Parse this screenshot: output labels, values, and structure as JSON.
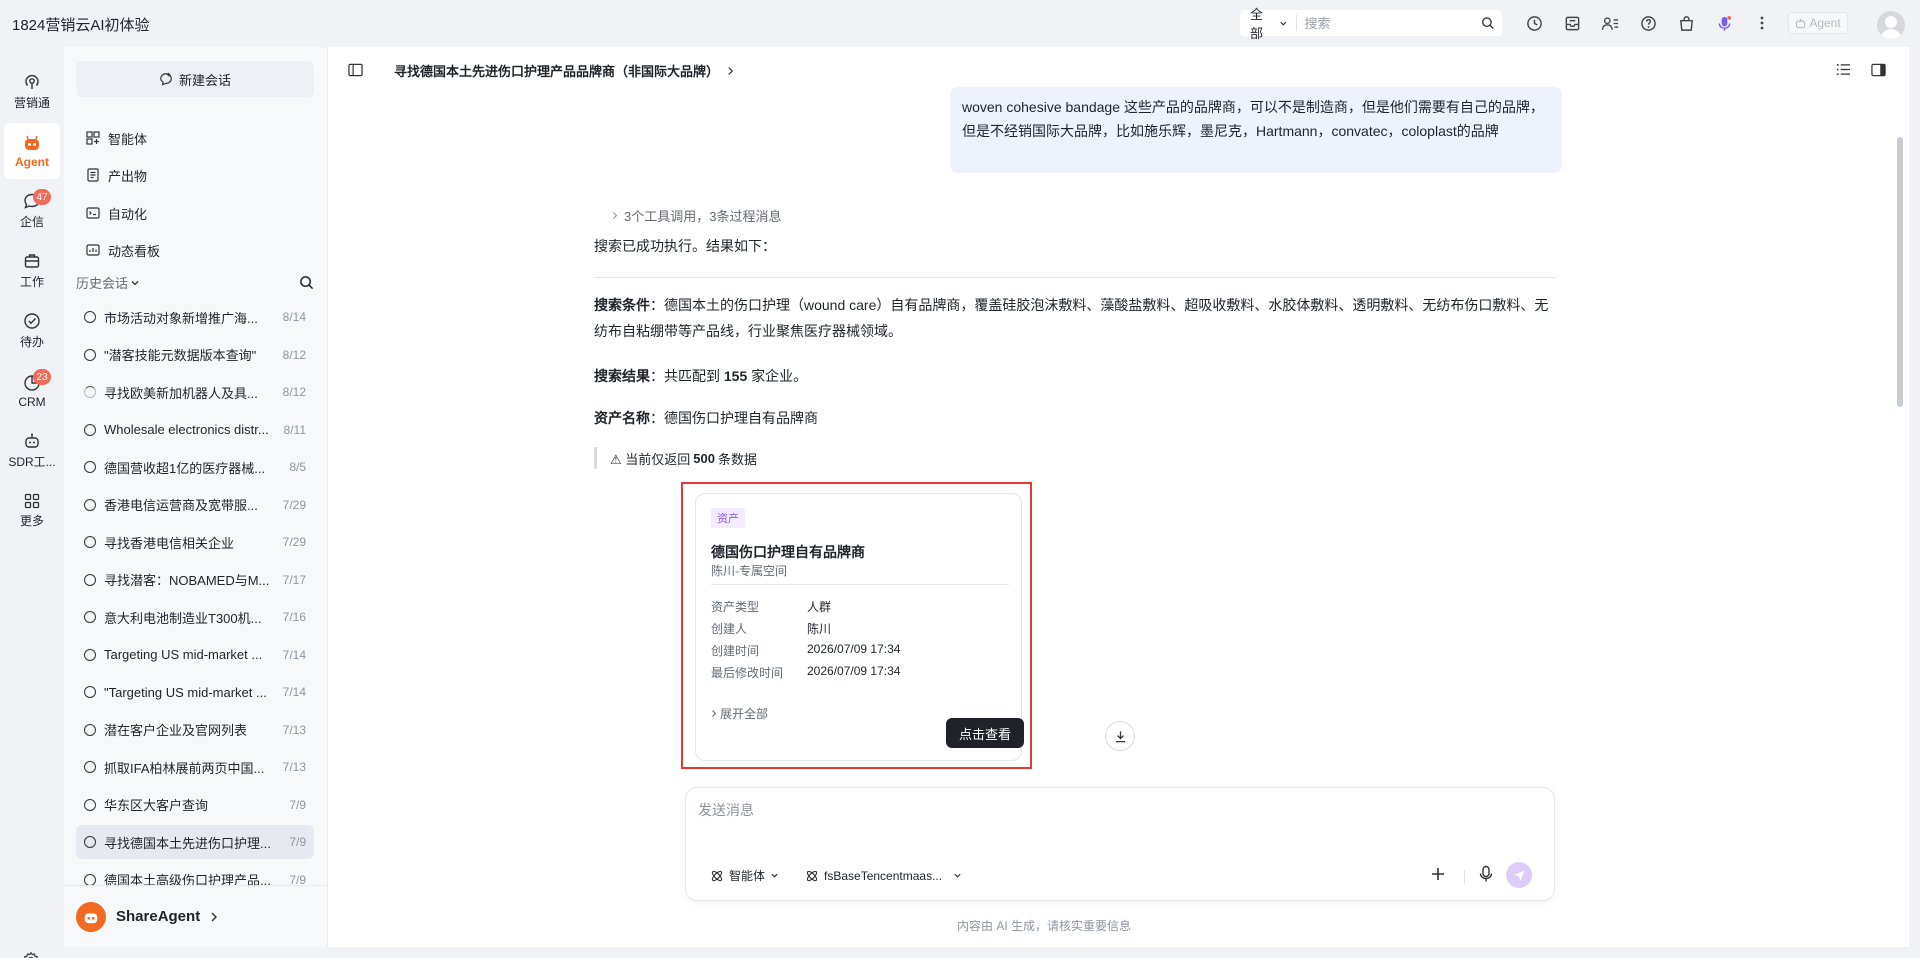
{
  "app": {
    "title": "1824营销云AI初体验"
  },
  "topbar": {
    "search_scope": "全部",
    "search_placeholder": "搜索",
    "agent_label": "Agent"
  },
  "rail": {
    "items": [
      {
        "label": "营销通",
        "icon": "broadcast-icon"
      },
      {
        "label": "Agent",
        "icon": "robot-icon",
        "active": true
      },
      {
        "label": "企信",
        "icon": "chat-icon",
        "badge": "47"
      },
      {
        "label": "工作",
        "icon": "briefcase-icon"
      },
      {
        "label": "待办",
        "icon": "check-circle-icon"
      },
      {
        "label": "CRM",
        "icon": "pie-chart-icon",
        "badge": "23"
      },
      {
        "label": "SDR工...",
        "icon": "bot-icon"
      },
      {
        "label": "更多",
        "icon": "grid-icon"
      }
    ]
  },
  "sidebar": {
    "new_chat": "新建会话",
    "nav": [
      "智能体",
      "产出物",
      "自动化",
      "动态看板"
    ],
    "history_label": "历史会话",
    "history": [
      {
        "title": "市场活动对象新增推广海...",
        "date": "8/14"
      },
      {
        "title": "\"潜客技能元数据版本查询\"",
        "date": "8/12"
      },
      {
        "title": "寻找欧美新加机器人及具...",
        "date": "8/12",
        "loading": true
      },
      {
        "title": "Wholesale electronics distr...",
        "date": "8/11"
      },
      {
        "title": "德国营收超1亿的医疗器械...",
        "date": "8/5"
      },
      {
        "title": "香港电信运营商及宽带服...",
        "date": "7/29"
      },
      {
        "title": "寻找香港电信相关企业",
        "date": "7/29"
      },
      {
        "title": "寻找潜客：NOBAMED与M...",
        "date": "7/17"
      },
      {
        "title": "意大利电池制造业T300机...",
        "date": "7/16"
      },
      {
        "title": "Targeting US mid-market ...",
        "date": "7/14"
      },
      {
        "title": "\"Targeting US mid-market ...",
        "date": "7/14"
      },
      {
        "title": "潜在客户企业及官网列表",
        "date": "7/13"
      },
      {
        "title": "抓取IFA柏林展前两页中国...",
        "date": "7/13"
      },
      {
        "title": "华东区大客户查询",
        "date": "7/9"
      },
      {
        "title": "寻找德国本土先进伤口护理...",
        "date": "7/9",
        "selected": true
      },
      {
        "title": "德国本土高级伤口护理产品...",
        "date": "7/9"
      }
    ],
    "footer_name": "ShareAgent"
  },
  "conversation": {
    "title": "寻找德国本土先进伤口护理产品品牌商（非国际大品牌）",
    "user_message": "woven cohesive bandage 这些产品的品牌商，可以不是制造商，但是他们需要有自己的品牌，但是不经销国际大品牌，比如施乐辉，墨尼克，Hartmann，convatec，coloplast的品牌",
    "tool_summary": "3个工具调用，3条过程消息",
    "intro": "搜索已成功执行。结果如下：",
    "cond_label": "搜索条件",
    "cond_text": "：德国本土的伤口护理（wound care）自有品牌商，覆盖硅胶泡沫敷料、藻酸盐敷料、超吸收敷料、水胶体敷料、透明敷料、无纺布伤口敷料、无纺布自粘绷带等产品线，行业聚焦医疗器械领域。",
    "result_label": "搜索结果",
    "result_prefix": "：共匹配到 ",
    "result_count": "155",
    "result_suffix": " 家企业。",
    "asset_label": "资产名称",
    "asset_text": "：德国伤口护理自有品牌商",
    "warn_prefix": "⚠ 当前仅返回",
    "warn_count": "500",
    "warn_suffix": "条数据"
  },
  "asset_card": {
    "tag": "资产",
    "name": "德国伤口护理自有品牌商",
    "space": "陈川-专属空间",
    "fields": [
      {
        "k": "资产类型",
        "v": "人群"
      },
      {
        "k": "创建人",
        "v": "陈川"
      },
      {
        "k": "创建时间",
        "v": "2026/07/09 17:34"
      },
      {
        "k": "最后修改时间",
        "v": "2026/07/09 17:34"
      }
    ],
    "expand": "展开全部",
    "view_button": "点击查看"
  },
  "composer": {
    "placeholder": "发送消息",
    "agent_selector": "智能体",
    "model_selector": "fsBaseTencentmaas..."
  },
  "disclaimer": "内容由 AI 生成，请核实重要信息",
  "colors": {
    "accent": "#f06a21",
    "highlight": "#e53935",
    "badge": "#f26a5a",
    "tag": "#8b56e6"
  }
}
